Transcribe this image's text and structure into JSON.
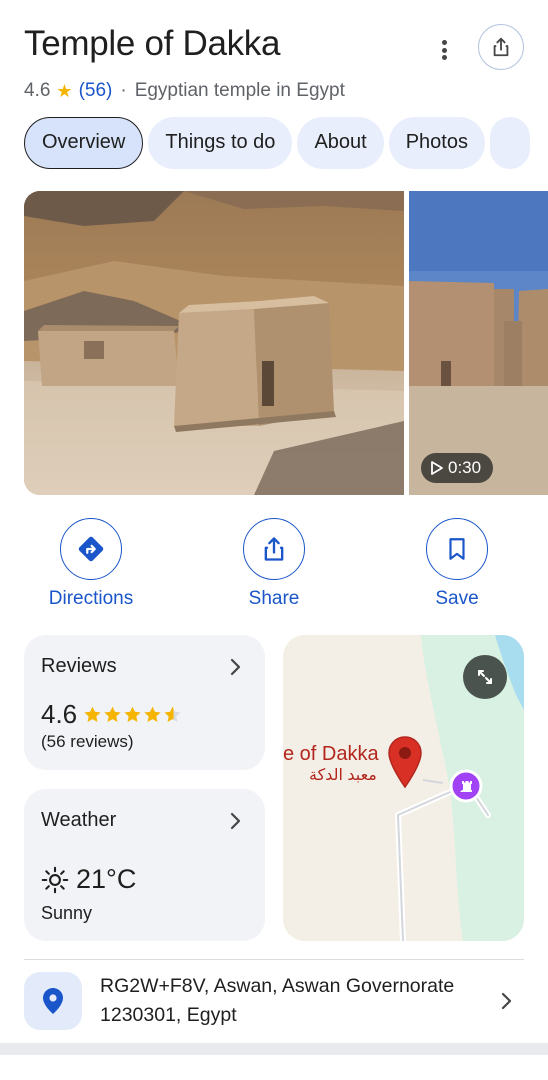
{
  "place": {
    "title": "Temple of Dakka",
    "rating": "4.6",
    "review_count": "(56)",
    "separator": "·",
    "category": "Egyptian temple in Egypt"
  },
  "tabs": [
    {
      "label": "Overview",
      "active": true
    },
    {
      "label": "Things to do",
      "active": false
    },
    {
      "label": "About",
      "active": false
    },
    {
      "label": "Photos",
      "active": false
    }
  ],
  "photos": {
    "video_duration": "0:30"
  },
  "actions": [
    {
      "label": "Directions",
      "icon": "directions-icon"
    },
    {
      "label": "Share",
      "icon": "share-icon"
    },
    {
      "label": "Save",
      "icon": "bookmark-icon"
    }
  ],
  "reviews_card": {
    "title": "Reviews",
    "rating": "4.6",
    "stars_out_of_5": 4.6,
    "count_text": "(56 reviews)"
  },
  "weather_card": {
    "title": "Weather",
    "temperature": "21°C",
    "condition": "Sunny"
  },
  "map": {
    "label_en": "e of Dakka",
    "label_ar": "معبد الدكة"
  },
  "address": {
    "line1": "RG2W+F8V, Aswan, Aswan Governorate",
    "line2": "1230301, Egypt"
  },
  "colors": {
    "accent_blue": "#1a56c9",
    "star_yellow": "#f4b400",
    "pin_red": "#d93025",
    "tab_bg": "#e8eefb",
    "card_bg": "#f1f3f6"
  }
}
